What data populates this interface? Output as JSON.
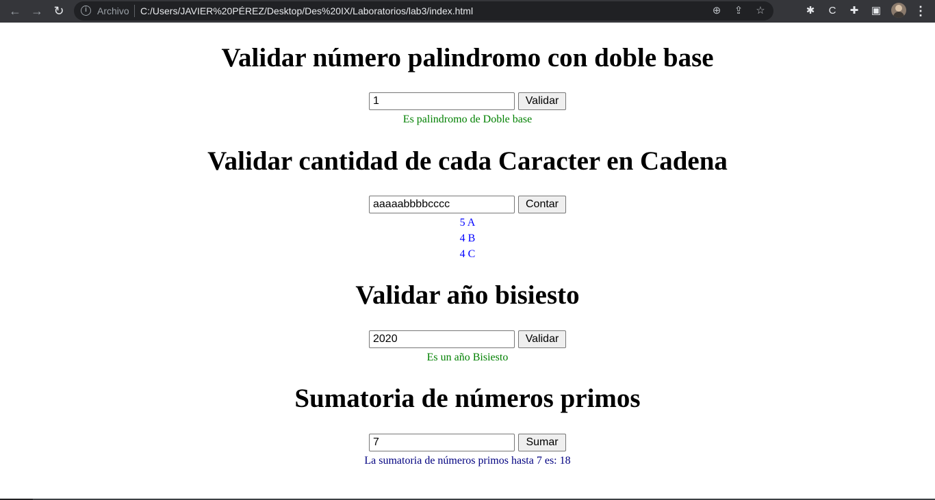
{
  "browser": {
    "back_icon": "←",
    "forward_icon": "→",
    "reload_icon": "↻",
    "info_icon": "i",
    "chip_label": "Archivo",
    "url": "C:/Users/JAVIER%20PÉREZ/Desktop/Des%20IX/Laboratorios/lab3/index.html",
    "zoom_icon": "⊕",
    "share_icon": "⇪",
    "star_icon": "☆",
    "ext_bug_icon": "✱",
    "ext_c_icon": "C",
    "puzzle_icon": "✚",
    "sidepanel_icon": "▣",
    "menu_icon": "⋮"
  },
  "sections": {
    "palindromo": {
      "title": "Validar número palindromo con doble base",
      "input_value": "1",
      "button_label": "Validar",
      "result": "Es palindromo de Doble base"
    },
    "caracteres": {
      "title": "Validar cantidad de cada Caracter en Cadena",
      "input_value": "aaaaabbbbcccc",
      "button_label": "Contar",
      "results": [
        "5 A",
        "4 B",
        "4 C"
      ]
    },
    "bisiesto": {
      "title": "Validar año bisiesto",
      "input_value": "2020",
      "button_label": "Validar",
      "result": "Es un año Bisiesto"
    },
    "primos": {
      "title": "Sumatoria de números primos",
      "input_value": "7",
      "button_label": "Sumar",
      "result": "La sumatoria de números primos hasta 7 es: 18"
    }
  },
  "colors": {
    "success": "#008000",
    "count": "#0000ff",
    "sum": "#000080"
  }
}
